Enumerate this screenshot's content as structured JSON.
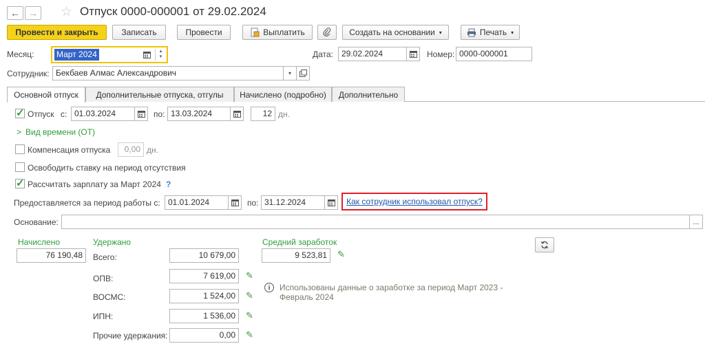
{
  "window": {
    "title": "Отпуск 0000-000001 от 29.02.2024"
  },
  "toolbar": {
    "post_close": "Провести и закрыть",
    "save": "Записать",
    "post": "Провести",
    "pay": "Выплатить",
    "create_based": "Создать на основании",
    "print": "Печать"
  },
  "header": {
    "month_label": "Месяц:",
    "month_value": "Март 2024",
    "date_label": "Дата:",
    "date_value": "29.02.2024",
    "number_label": "Номер:",
    "number_value": "0000-000001",
    "employee_label": "Сотрудник:",
    "employee_value": "Бекбаев Алмас Александрович"
  },
  "tabs": [
    {
      "label": "Основной отпуск",
      "active": true
    },
    {
      "label": "Дополнительные отпуска, отгулы",
      "active": false
    },
    {
      "label": "Начислено (подробно)",
      "active": false
    },
    {
      "label": "Дополнительно",
      "active": false
    }
  ],
  "vacation": {
    "checkbox_label": "Отпуск",
    "from_label": "с:",
    "from_value": "01.03.2024",
    "to_label": "по:",
    "to_value": "13.03.2024",
    "days_value": "12",
    "days_unit": "дн.",
    "time_type_link": "Вид времени (ОТ)"
  },
  "compensation": {
    "label": "Компенсация отпуска",
    "value": "0,00",
    "unit": "дн.",
    "checked": false
  },
  "release_rate": {
    "label": "Освободить ставку на период отсутствия",
    "checked": false
  },
  "calc_salary": {
    "label": "Рассчитать зарплату за Март 2024",
    "checked": true,
    "help": "?"
  },
  "work_period": {
    "label": "Предоставляется за период работы с:",
    "from_value": "01.01.2024",
    "to_label": "по:",
    "to_value": "31.12.2024",
    "history_link": "Как сотрудник использовал отпуск?"
  },
  "basis": {
    "label": "Основание:",
    "value": "",
    "select_button": "..."
  },
  "totals": {
    "accrued_label": "Начислено",
    "accrued_value": "76 190,48",
    "withheld_label": "Удержано",
    "avg_label": "Средний заработок",
    "avg_value": "9 523,81",
    "rows": [
      {
        "label": "Всего:",
        "value": "10 679,00",
        "editable": false
      },
      {
        "label": "ОПВ:",
        "value": "7 619,00",
        "editable": true
      },
      {
        "label": "ВОСМС:",
        "value": "1 524,00",
        "editable": true
      },
      {
        "label": "ИПН:",
        "value": "1 536,00",
        "editable": true
      },
      {
        "label": "Прочие удержания:",
        "value": "0,00",
        "editable": true
      }
    ],
    "info_text": "Использованы данные о заработке за период Март 2023 - Февраль 2024"
  }
}
